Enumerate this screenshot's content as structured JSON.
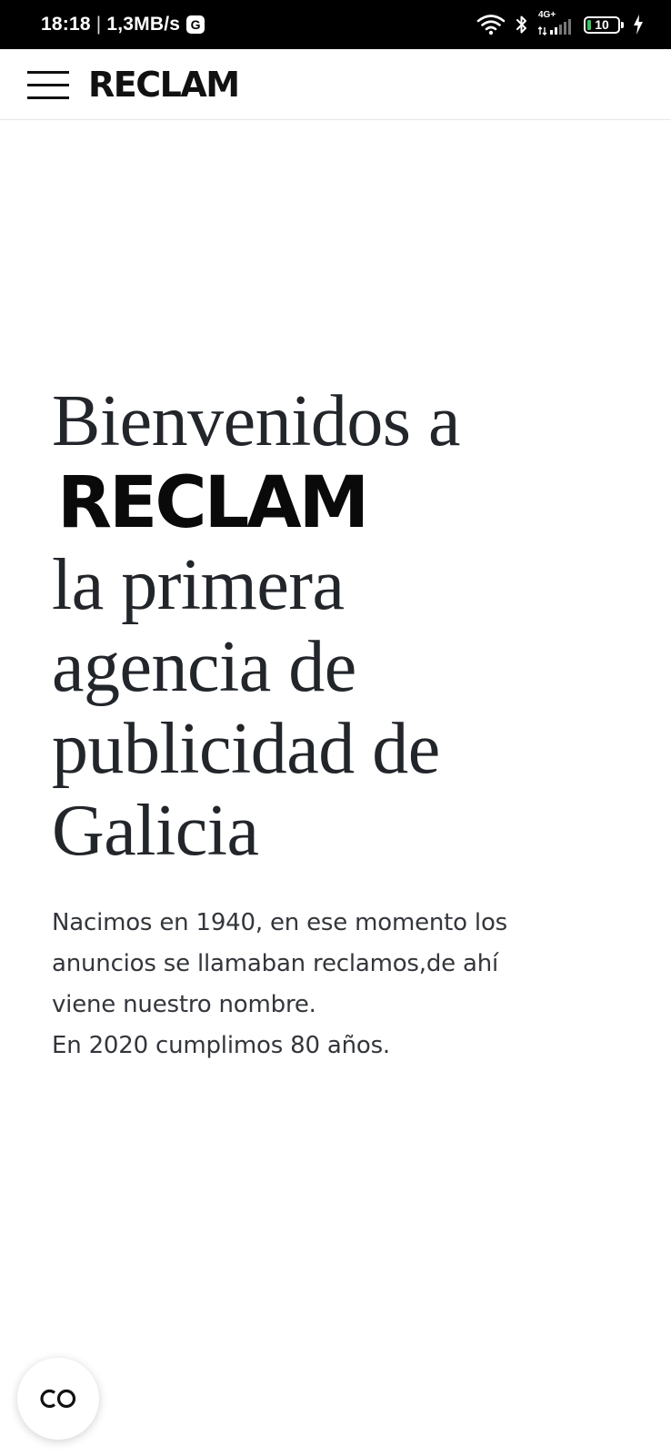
{
  "status_bar": {
    "time": "18:18",
    "separator": "|",
    "speed": "1,3MB/s",
    "notification_icon_letter": "G",
    "network_label": "4G+",
    "battery_level": "10",
    "icons": [
      "wifi-icon",
      "bluetooth-icon",
      "signal-icon",
      "battery-icon",
      "charging-icon"
    ]
  },
  "header": {
    "logo": "RECLAM",
    "menu_icon": "hamburger-menu-icon"
  },
  "hero": {
    "line1": "Bienvenidos a",
    "brand": "RECLAM",
    "line3": "la primera",
    "line4": "agencia de",
    "line5": "publicidad de",
    "line6": "Galicia"
  },
  "intro": {
    "line1": "Nacimos en 1940, en ese momento los",
    "line2": "anuncios se llamaban reclamos,de ahí",
    "line3": "viene nuestro nombre.",
    "line4": "En 2020 cumplimos 80 años."
  },
  "floating_button": {
    "icon": "co-logo-icon"
  },
  "colors": {
    "status_bar_bg": "#000000",
    "text_dark": "#22252a",
    "logo": "#111111",
    "battery_low": "#36c95f"
  }
}
